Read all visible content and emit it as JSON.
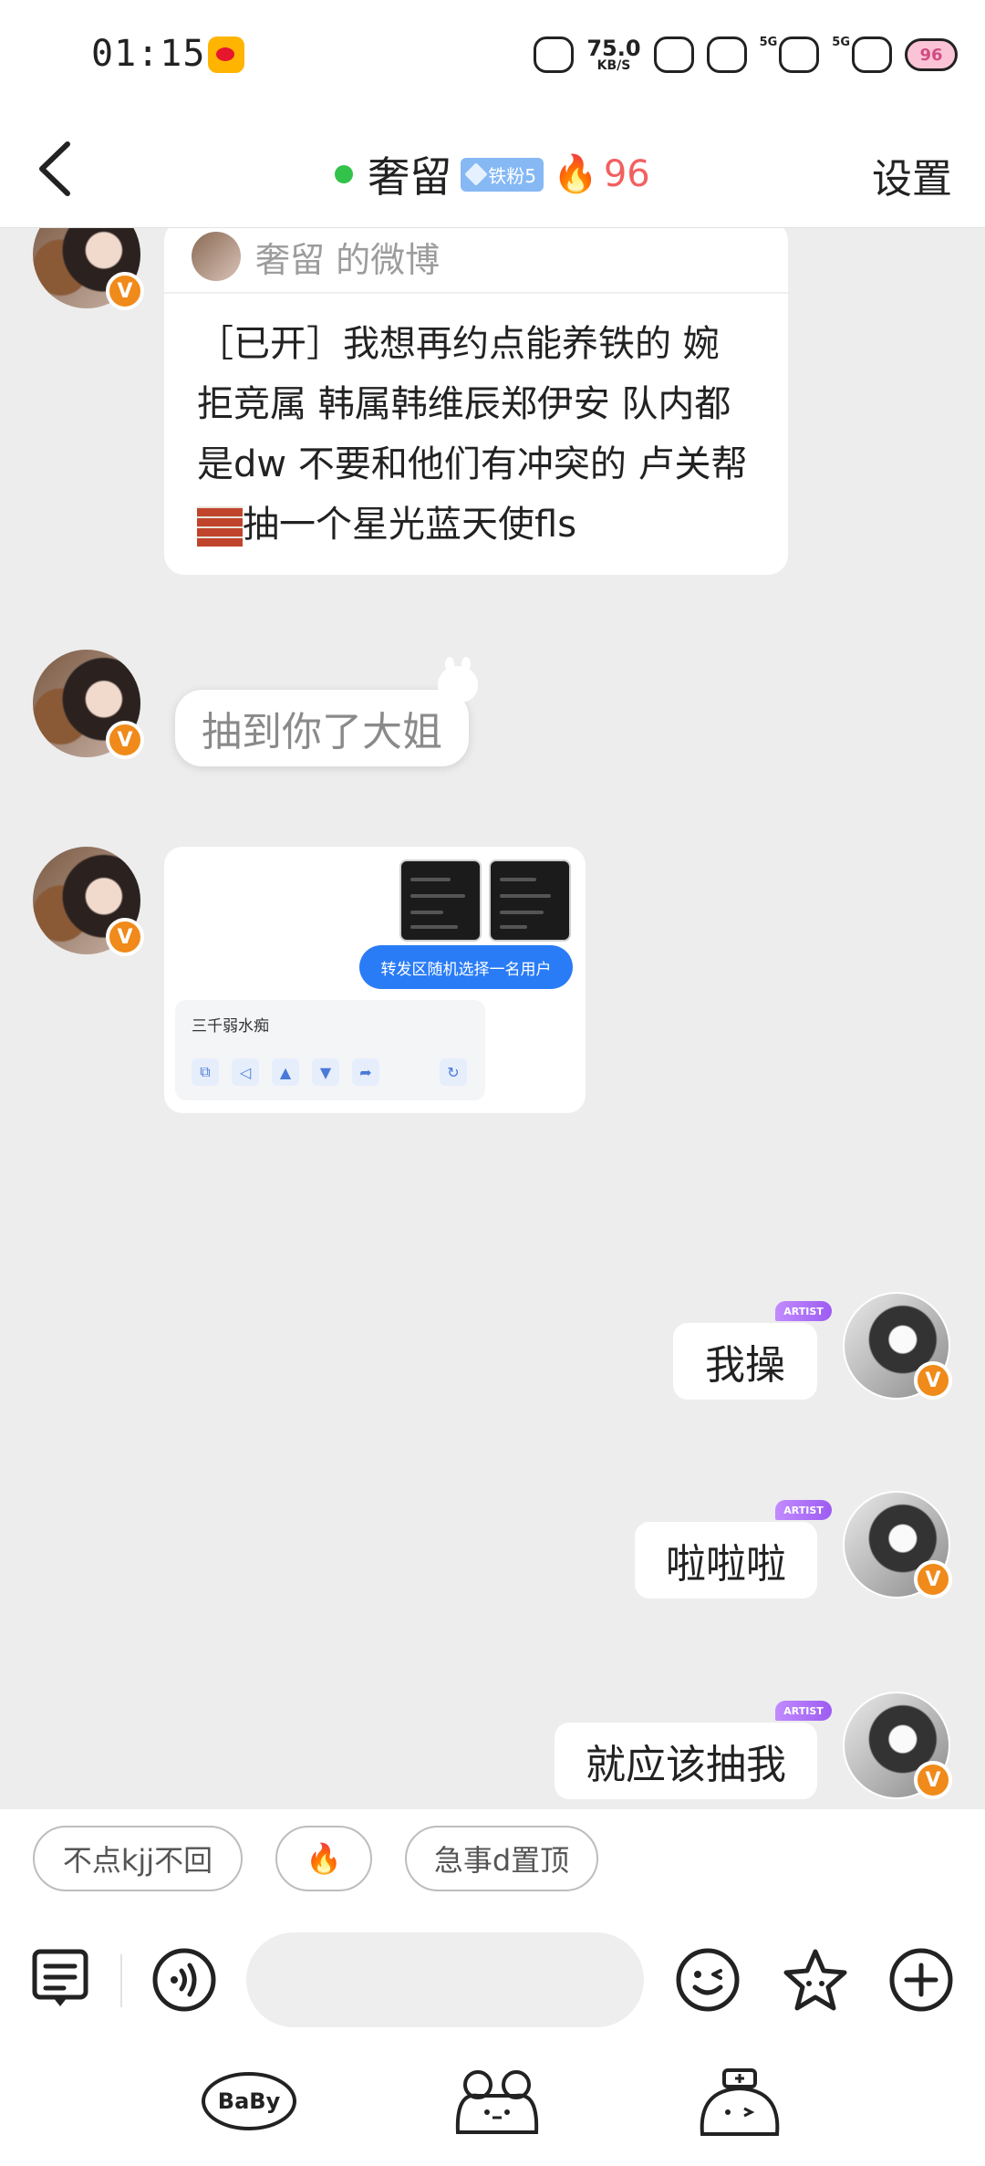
{
  "status_bar": {
    "time": "01:15",
    "net_speed_value": "75.0",
    "net_speed_unit": "KB/S",
    "sim1": "5G",
    "sim2": "5G",
    "battery": "96"
  },
  "header": {
    "name": "奢留",
    "fan_badge": "铁粉5",
    "fire_level": "96",
    "settings_label": "设置"
  },
  "messages": {
    "repost_source": "奢留 的微博",
    "repost_text_before": "［已开］我想再约点能养铁的 婉拒竞属 韩属韩维辰郑伊安 队内都是dw 不要和他们有冲突的 卢关帮",
    "repost_text_after": "抽一个星光蓝天使fls",
    "msg2": "抽到你了大姐",
    "screenshot_button": "转发区随机选择一名用户",
    "screenshot_name": "三千弱水痴",
    "msg4": "我操",
    "msg5": "啦啦啦",
    "msg6": "就应该抽我",
    "artist_tag": "ARTIST",
    "verified": "V"
  },
  "quick_replies": [
    "不点kjj不回",
    "🔥",
    "急事d置顶"
  ],
  "input": {
    "placeholder": ""
  },
  "stickers": [
    "BaBy",
    "frog",
    "nurse-frog"
  ],
  "colors": {
    "online": "#33c24a",
    "fire_text": "#f26060",
    "verified_badge": "#f08a1a",
    "action_blue": "#2a7cf6"
  }
}
